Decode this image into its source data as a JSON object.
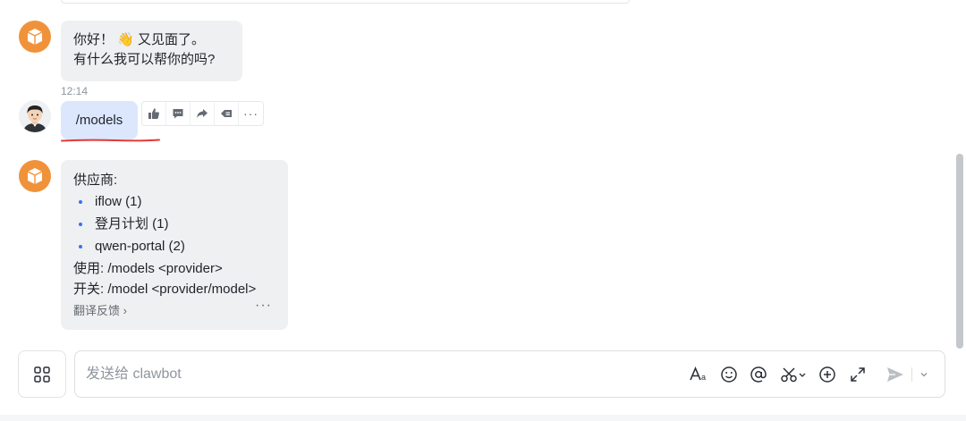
{
  "messages": {
    "bot_greeting": {
      "line1_before": "你好！",
      "emoji": "👋",
      "line1_after": " 又见面了。",
      "line2": "有什么我可以帮你的吗?"
    },
    "user_message": {
      "timestamp": "12:14",
      "text": "/models"
    },
    "bot_reply": {
      "heading": "供应商:",
      "providers": [
        "iflow (1)",
        "登月计划 (1)",
        "qwen-portal (2)"
      ],
      "usage_line": "使用: /models <provider>",
      "switch_line": "开关: /model <provider/model>",
      "translate_feedback": "翻译反馈",
      "translate_chevron": "›",
      "more": "···"
    }
  },
  "message_actions": [
    {
      "icon": "thumbs-up-icon"
    },
    {
      "icon": "reply-icon"
    },
    {
      "icon": "forward-icon"
    },
    {
      "icon": "quote-icon"
    },
    {
      "icon": "more-icon",
      "label": "···"
    }
  ],
  "composer": {
    "placeholder": "发送给 clawbot",
    "value": "",
    "tools": [
      "font-format-icon",
      "emoji-icon",
      "mention-icon",
      "scissors-icon",
      "add-icon",
      "expand-icon",
      "send-icon",
      "send-options-chevron-icon"
    ]
  },
  "colors": {
    "bot_avatar": "#f0923a",
    "user_bubble": "#dce7fd",
    "bot_bubble": "#eff0f1",
    "underline_annotation": "#e53935",
    "bullet": "#3370ff"
  }
}
